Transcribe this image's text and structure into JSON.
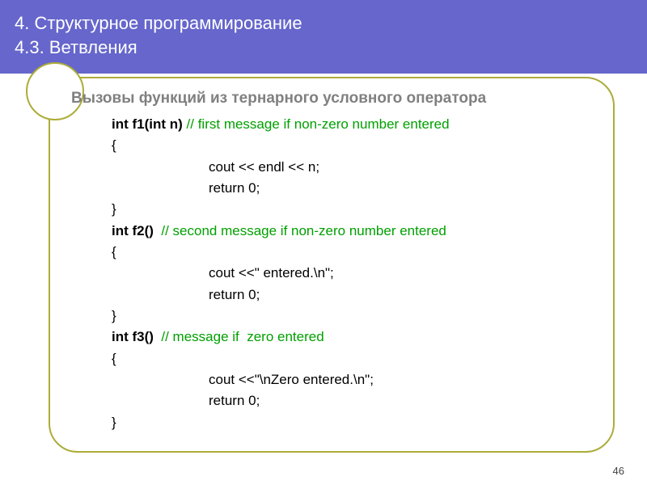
{
  "header": {
    "title": "4. Структурное программирование",
    "subtitle": "4.3. Ветвления"
  },
  "content": {
    "subheading": "Вызовы функций из тернарного условного оператора",
    "func1": {
      "sig": "int f1(int n)",
      "comment": " // first message if non-zero number entered",
      "open": "{",
      "l1": "cout << endl << n;",
      "l2": "return 0;",
      "close": "}"
    },
    "func2": {
      "sig": "int f2()",
      "comment": "  // second message if non-zero number entered",
      "open": "{",
      "l1": "cout <<\" entered.\\n\";",
      "l2": "return 0;",
      "close": "}"
    },
    "func3": {
      "sig": "int f3()",
      "comment": "  // message if  zero entered",
      "open": "{",
      "l1": "cout <<\"\\nZero entered.\\n\";",
      "l2": "return 0;",
      "close": "}"
    }
  },
  "page_number": "46"
}
